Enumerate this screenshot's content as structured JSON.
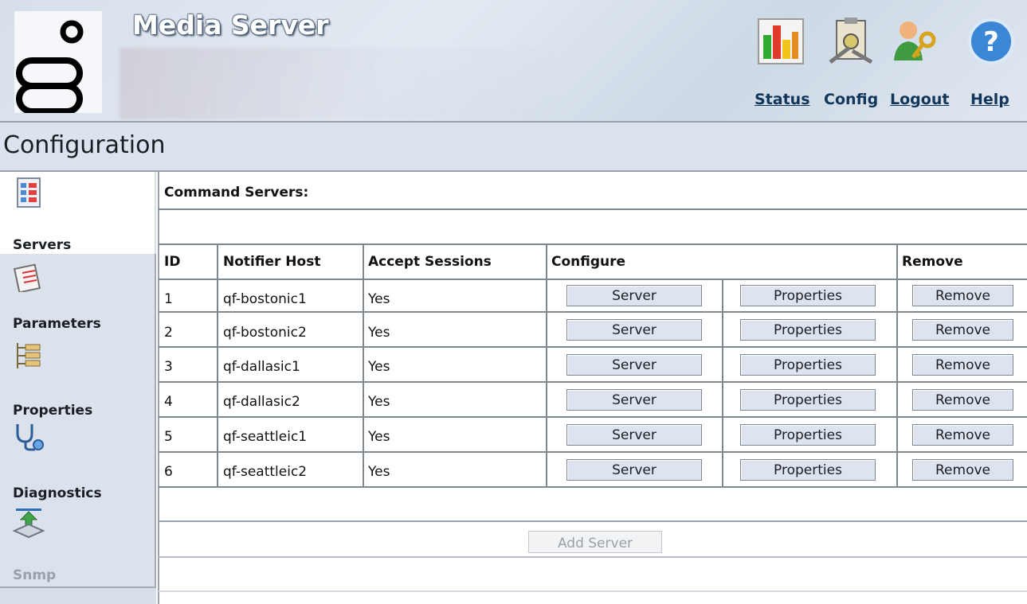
{
  "header": {
    "app_title": "Media Server",
    "icons": [
      "status-chart-icon",
      "config-clipboard-icon",
      "logout-user-key-icon",
      "help-icon"
    ],
    "links": {
      "status": "Status",
      "config": "Config",
      "logout": "Logout",
      "help": "Help"
    }
  },
  "page": {
    "title": "Configuration"
  },
  "sidebar": {
    "items": [
      {
        "label": "Servers",
        "icon": "servers-icon"
      },
      {
        "label": "Parameters",
        "icon": "parameters-icon"
      },
      {
        "label": "Properties",
        "icon": "properties-icon"
      },
      {
        "label": "Diagnostics",
        "icon": "stethoscope-icon"
      },
      {
        "label": "Snmp",
        "icon": "snmp-icon"
      }
    ]
  },
  "main": {
    "section_title": "Command Servers:",
    "columns": [
      "ID",
      "Notifier Host",
      "Accept Sessions",
      "Configure",
      "Remove"
    ],
    "rows": [
      {
        "id": "1",
        "host": "qf-bostonic1",
        "accept": "Yes"
      },
      {
        "id": "2",
        "host": "qf-bostonic2",
        "accept": "Yes"
      },
      {
        "id": "3",
        "host": "qf-dallasic1",
        "accept": "Yes"
      },
      {
        "id": "4",
        "host": "qf-dallasic2",
        "accept": "Yes"
      },
      {
        "id": "5",
        "host": "qf-seattleic1",
        "accept": "Yes"
      },
      {
        "id": "6",
        "host": "qf-seattleic2",
        "accept": "Yes"
      }
    ],
    "buttons": {
      "server": "Server",
      "properties": "Properties",
      "remove": "Remove",
      "add_server": "Add Server"
    }
  }
}
